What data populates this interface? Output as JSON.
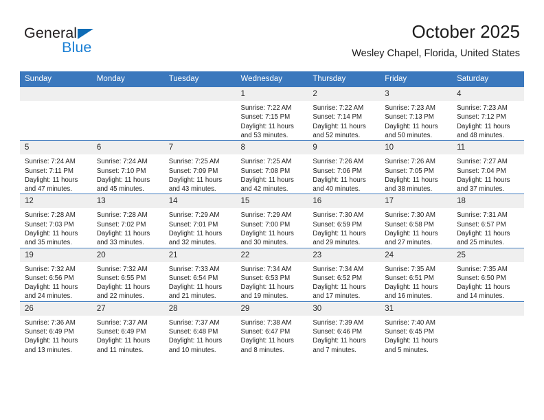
{
  "brand": {
    "name_part1": "General",
    "name_part2": "Blue",
    "triangle_icon": "triangle-icon",
    "colors": {
      "dark": "#231f20",
      "blue": "#1a7fd4",
      "triangle": "#0f6cb6"
    }
  },
  "header": {
    "title": "October 2025",
    "subtitle": "Wesley Chapel, Florida, United States"
  },
  "theme": {
    "header_blue": "#3b78bd",
    "daynum_band": "#efefef",
    "cell_background": "#ffffff",
    "text": "#232323"
  },
  "weekdays": [
    "Sunday",
    "Monday",
    "Tuesday",
    "Wednesday",
    "Thursday",
    "Friday",
    "Saturday"
  ],
  "weeks": [
    [
      {
        "day": "",
        "blank": true
      },
      {
        "day": "",
        "blank": true
      },
      {
        "day": "",
        "blank": true
      },
      {
        "day": "1",
        "sunrise": "Sunrise: 7:22 AM",
        "sunset": "Sunset: 7:15 PM",
        "daylight1": "Daylight: 11 hours",
        "daylight2": "and 53 minutes."
      },
      {
        "day": "2",
        "sunrise": "Sunrise: 7:22 AM",
        "sunset": "Sunset: 7:14 PM",
        "daylight1": "Daylight: 11 hours",
        "daylight2": "and 52 minutes."
      },
      {
        "day": "3",
        "sunrise": "Sunrise: 7:23 AM",
        "sunset": "Sunset: 7:13 PM",
        "daylight1": "Daylight: 11 hours",
        "daylight2": "and 50 minutes."
      },
      {
        "day": "4",
        "sunrise": "Sunrise: 7:23 AM",
        "sunset": "Sunset: 7:12 PM",
        "daylight1": "Daylight: 11 hours",
        "daylight2": "and 48 minutes."
      }
    ],
    [
      {
        "day": "5",
        "sunrise": "Sunrise: 7:24 AM",
        "sunset": "Sunset: 7:11 PM",
        "daylight1": "Daylight: 11 hours",
        "daylight2": "and 47 minutes."
      },
      {
        "day": "6",
        "sunrise": "Sunrise: 7:24 AM",
        "sunset": "Sunset: 7:10 PM",
        "daylight1": "Daylight: 11 hours",
        "daylight2": "and 45 minutes."
      },
      {
        "day": "7",
        "sunrise": "Sunrise: 7:25 AM",
        "sunset": "Sunset: 7:09 PM",
        "daylight1": "Daylight: 11 hours",
        "daylight2": "and 43 minutes."
      },
      {
        "day": "8",
        "sunrise": "Sunrise: 7:25 AM",
        "sunset": "Sunset: 7:08 PM",
        "daylight1": "Daylight: 11 hours",
        "daylight2": "and 42 minutes."
      },
      {
        "day": "9",
        "sunrise": "Sunrise: 7:26 AM",
        "sunset": "Sunset: 7:06 PM",
        "daylight1": "Daylight: 11 hours",
        "daylight2": "and 40 minutes."
      },
      {
        "day": "10",
        "sunrise": "Sunrise: 7:26 AM",
        "sunset": "Sunset: 7:05 PM",
        "daylight1": "Daylight: 11 hours",
        "daylight2": "and 38 minutes."
      },
      {
        "day": "11",
        "sunrise": "Sunrise: 7:27 AM",
        "sunset": "Sunset: 7:04 PM",
        "daylight1": "Daylight: 11 hours",
        "daylight2": "and 37 minutes."
      }
    ],
    [
      {
        "day": "12",
        "sunrise": "Sunrise: 7:28 AM",
        "sunset": "Sunset: 7:03 PM",
        "daylight1": "Daylight: 11 hours",
        "daylight2": "and 35 minutes."
      },
      {
        "day": "13",
        "sunrise": "Sunrise: 7:28 AM",
        "sunset": "Sunset: 7:02 PM",
        "daylight1": "Daylight: 11 hours",
        "daylight2": "and 33 minutes."
      },
      {
        "day": "14",
        "sunrise": "Sunrise: 7:29 AM",
        "sunset": "Sunset: 7:01 PM",
        "daylight1": "Daylight: 11 hours",
        "daylight2": "and 32 minutes."
      },
      {
        "day": "15",
        "sunrise": "Sunrise: 7:29 AM",
        "sunset": "Sunset: 7:00 PM",
        "daylight1": "Daylight: 11 hours",
        "daylight2": "and 30 minutes."
      },
      {
        "day": "16",
        "sunrise": "Sunrise: 7:30 AM",
        "sunset": "Sunset: 6:59 PM",
        "daylight1": "Daylight: 11 hours",
        "daylight2": "and 29 minutes."
      },
      {
        "day": "17",
        "sunrise": "Sunrise: 7:30 AM",
        "sunset": "Sunset: 6:58 PM",
        "daylight1": "Daylight: 11 hours",
        "daylight2": "and 27 minutes."
      },
      {
        "day": "18",
        "sunrise": "Sunrise: 7:31 AM",
        "sunset": "Sunset: 6:57 PM",
        "daylight1": "Daylight: 11 hours",
        "daylight2": "and 25 minutes."
      }
    ],
    [
      {
        "day": "19",
        "sunrise": "Sunrise: 7:32 AM",
        "sunset": "Sunset: 6:56 PM",
        "daylight1": "Daylight: 11 hours",
        "daylight2": "and 24 minutes."
      },
      {
        "day": "20",
        "sunrise": "Sunrise: 7:32 AM",
        "sunset": "Sunset: 6:55 PM",
        "daylight1": "Daylight: 11 hours",
        "daylight2": "and 22 minutes."
      },
      {
        "day": "21",
        "sunrise": "Sunrise: 7:33 AM",
        "sunset": "Sunset: 6:54 PM",
        "daylight1": "Daylight: 11 hours",
        "daylight2": "and 21 minutes."
      },
      {
        "day": "22",
        "sunrise": "Sunrise: 7:34 AM",
        "sunset": "Sunset: 6:53 PM",
        "daylight1": "Daylight: 11 hours",
        "daylight2": "and 19 minutes."
      },
      {
        "day": "23",
        "sunrise": "Sunrise: 7:34 AM",
        "sunset": "Sunset: 6:52 PM",
        "daylight1": "Daylight: 11 hours",
        "daylight2": "and 17 minutes."
      },
      {
        "day": "24",
        "sunrise": "Sunrise: 7:35 AM",
        "sunset": "Sunset: 6:51 PM",
        "daylight1": "Daylight: 11 hours",
        "daylight2": "and 16 minutes."
      },
      {
        "day": "25",
        "sunrise": "Sunrise: 7:35 AM",
        "sunset": "Sunset: 6:50 PM",
        "daylight1": "Daylight: 11 hours",
        "daylight2": "and 14 minutes."
      }
    ],
    [
      {
        "day": "26",
        "sunrise": "Sunrise: 7:36 AM",
        "sunset": "Sunset: 6:49 PM",
        "daylight1": "Daylight: 11 hours",
        "daylight2": "and 13 minutes."
      },
      {
        "day": "27",
        "sunrise": "Sunrise: 7:37 AM",
        "sunset": "Sunset: 6:49 PM",
        "daylight1": "Daylight: 11 hours",
        "daylight2": "and 11 minutes."
      },
      {
        "day": "28",
        "sunrise": "Sunrise: 7:37 AM",
        "sunset": "Sunset: 6:48 PM",
        "daylight1": "Daylight: 11 hours",
        "daylight2": "and 10 minutes."
      },
      {
        "day": "29",
        "sunrise": "Sunrise: 7:38 AM",
        "sunset": "Sunset: 6:47 PM",
        "daylight1": "Daylight: 11 hours",
        "daylight2": "and 8 minutes."
      },
      {
        "day": "30",
        "sunrise": "Sunrise: 7:39 AM",
        "sunset": "Sunset: 6:46 PM",
        "daylight1": "Daylight: 11 hours",
        "daylight2": "and 7 minutes."
      },
      {
        "day": "31",
        "sunrise": "Sunrise: 7:40 AM",
        "sunset": "Sunset: 6:45 PM",
        "daylight1": "Daylight: 11 hours",
        "daylight2": "and 5 minutes."
      },
      {
        "day": "",
        "blank": true
      }
    ]
  ]
}
